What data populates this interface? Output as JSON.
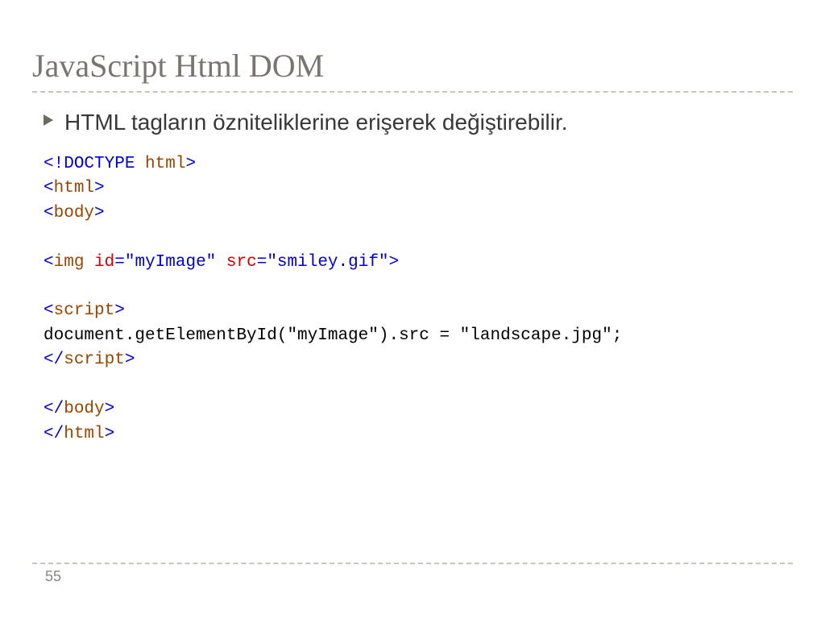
{
  "title": "JavaScript Html DOM",
  "bullet": "HTML tagların özniteliklerine erişerek değiştirebilir.",
  "code": {
    "l1a": "<!",
    "l1b": "DOCTYPE",
    "l1c": " ",
    "l1d": "html",
    "l1e": ">",
    "l2a": "<",
    "l2b": "html",
    "l2c": ">",
    "l3a": "<",
    "l3b": "body",
    "l3c": ">",
    "l5a": "<",
    "l5b": "img",
    "l5c": " ",
    "l5d": "id",
    "l5e": "=",
    "l5f": "\"myImage\"",
    "l5g": " ",
    "l5h": "src",
    "l5i": "=",
    "l5j": "\"smiley.gif\"",
    "l5k": ">",
    "l7a": "<",
    "l7b": "script",
    "l7c": ">",
    "l8": "document.getElementById(\"myImage\").src = \"landscape.jpg\";",
    "l9a": "</",
    "l9b": "script",
    "l9c": ">",
    "l11a": "</",
    "l11b": "body",
    "l11c": ">",
    "l12a": "</",
    "l12b": "html",
    "l12c": ">"
  },
  "page_number": "55"
}
